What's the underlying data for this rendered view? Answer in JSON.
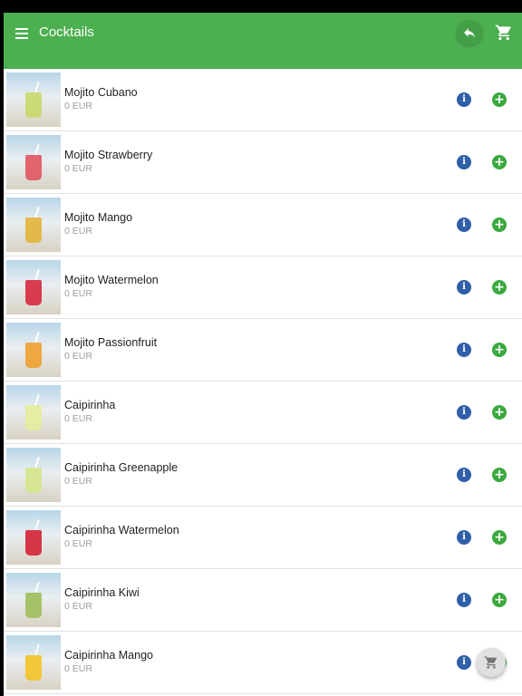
{
  "header": {
    "title": "Cocktails",
    "menu_icon": "menu-icon",
    "back_icon": "reply-icon",
    "cart_icon": "cart-icon"
  },
  "colors": {
    "appbar": "#4caf50",
    "info": "#2f5fa8",
    "add": "#3aa93e"
  },
  "items": [
    {
      "name": "Mojito Cubano",
      "price": "0 EUR",
      "drink_color": "#c9d86a"
    },
    {
      "name": "Mojito Strawberry",
      "price": "0 EUR",
      "drink_color": "#e05560"
    },
    {
      "name": "Mojito Mango",
      "price": "0 EUR",
      "drink_color": "#e2b43a"
    },
    {
      "name": "Mojito Watermelon",
      "price": "0 EUR",
      "drink_color": "#d6283f"
    },
    {
      "name": "Mojito Passionfruit",
      "price": "0 EUR",
      "drink_color": "#f0a030"
    },
    {
      "name": "Caipirinha",
      "price": "0 EUR",
      "drink_color": "#e6ec9a"
    },
    {
      "name": "Caipirinha Greenapple",
      "price": "0 EUR",
      "drink_color": "#d4e68a"
    },
    {
      "name": "Caipirinha Watermelon",
      "price": "0 EUR",
      "drink_color": "#d42235"
    },
    {
      "name": "Caipirinha Kiwi",
      "price": "0 EUR",
      "drink_color": "#9fbe5a"
    },
    {
      "name": "Caipirinha Mango",
      "price": "0 EUR",
      "drink_color": "#f3c325"
    }
  ],
  "actions": {
    "info_symbol": "i",
    "add_symbol": "+"
  },
  "fab": {
    "icon": "cart-icon"
  }
}
